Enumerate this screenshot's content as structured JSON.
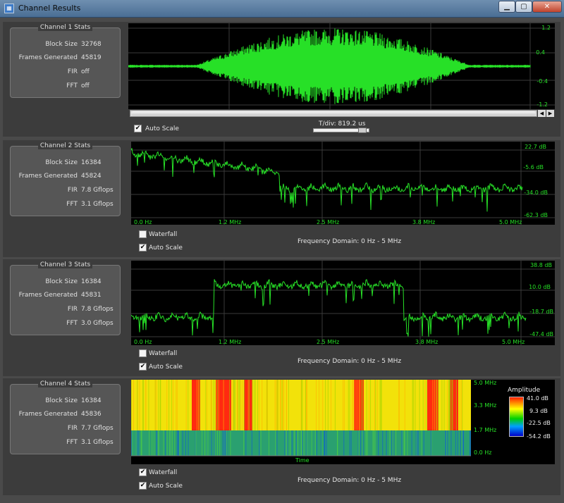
{
  "window": {
    "title": "Channel Results",
    "app_icon": "app-icon",
    "buttons": {
      "minimize": "▁",
      "maximize": "▢",
      "close": "✕"
    }
  },
  "channels": [
    {
      "title": "Channel 1 Stats",
      "stats": [
        {
          "label": "Block Size",
          "value": "32768"
        },
        {
          "label": "Frames Generated",
          "value": "45819"
        },
        {
          "label": "FIR",
          "value": "off"
        },
        {
          "label": "FFT",
          "value": "off"
        }
      ],
      "plot": {
        "y_labels": [
          "1.2",
          "0.4",
          "-0.4",
          "-1.2"
        ]
      },
      "controls": {
        "auto_scale": {
          "label": "Auto Scale",
          "checked": true
        },
        "tdiv_label": "T/div: 819.2 us"
      }
    },
    {
      "title": "Channel 2 Stats",
      "stats": [
        {
          "label": "Block Size",
          "value": "16384"
        },
        {
          "label": "Frames Generated",
          "value": "45824"
        },
        {
          "label": "FIR",
          "value": "7.8 Gflops"
        },
        {
          "label": "FFT",
          "value": "3.1 Gflops"
        }
      ],
      "plot": {
        "y_labels": [
          "22.7 dB",
          "-5.6 dB",
          "-34.0 dB",
          "-62.3 dB"
        ],
        "x_labels": [
          "0.0 Hz",
          "1.2 MHz",
          "2.5 MHz",
          "3.8 MHz",
          "5.0 MHz"
        ]
      },
      "controls": {
        "waterfall": {
          "label": "Waterfall",
          "checked": false
        },
        "auto_scale": {
          "label": "Auto Scale",
          "checked": true
        },
        "freq_domain": "Frequency Domain: 0 Hz - 5 MHz"
      }
    },
    {
      "title": "Channel 3 Stats",
      "stats": [
        {
          "label": "Block Size",
          "value": "16384"
        },
        {
          "label": "Frames Generated",
          "value": "45831"
        },
        {
          "label": "FIR",
          "value": "7.8 Gflops"
        },
        {
          "label": "FFT",
          "value": "3.0 Gflops"
        }
      ],
      "plot": {
        "y_labels": [
          "38.8 dB",
          "10.0 dB",
          "-18.7 dB",
          "-47.4 dB"
        ],
        "x_labels": [
          "0.0 Hz",
          "1.2 MHz",
          "2.5 MHz",
          "3.8 MHz",
          "5.0 MHz"
        ]
      },
      "controls": {
        "waterfall": {
          "label": "Waterfall",
          "checked": false
        },
        "auto_scale": {
          "label": "Auto Scale",
          "checked": true
        },
        "freq_domain": "Frequency Domain: 0 Hz - 5 MHz"
      }
    },
    {
      "title": "Channel 4 Stats",
      "stats": [
        {
          "label": "Block Size",
          "value": "16384"
        },
        {
          "label": "Frames Generated",
          "value": "45836"
        },
        {
          "label": "FIR",
          "value": "7.7 Gflops"
        },
        {
          "label": "FFT",
          "value": "3.1 Gflops"
        }
      ],
      "plot": {
        "y_labels": [
          "5.0 MHz",
          "3.3 MHz",
          "1.7 MHz",
          "0.0 Hz"
        ],
        "x_title": "Time",
        "legend_title": "Amplitude",
        "legend_labels": [
          "41.0 dB",
          "9.3 dB",
          "-22.5 dB",
          "-54.2 dB"
        ]
      },
      "controls": {
        "waterfall": {
          "label": "Waterfall",
          "checked": true
        },
        "auto_scale": {
          "label": "Auto Scale",
          "checked": true
        },
        "freq_domain": "Frequency Domain: 0 Hz - 5 MHz"
      }
    }
  ],
  "colors": {
    "trace": "#27e027",
    "plot_bg": "#000000",
    "grid": "#3a3a3a"
  },
  "check_mark": "✔"
}
